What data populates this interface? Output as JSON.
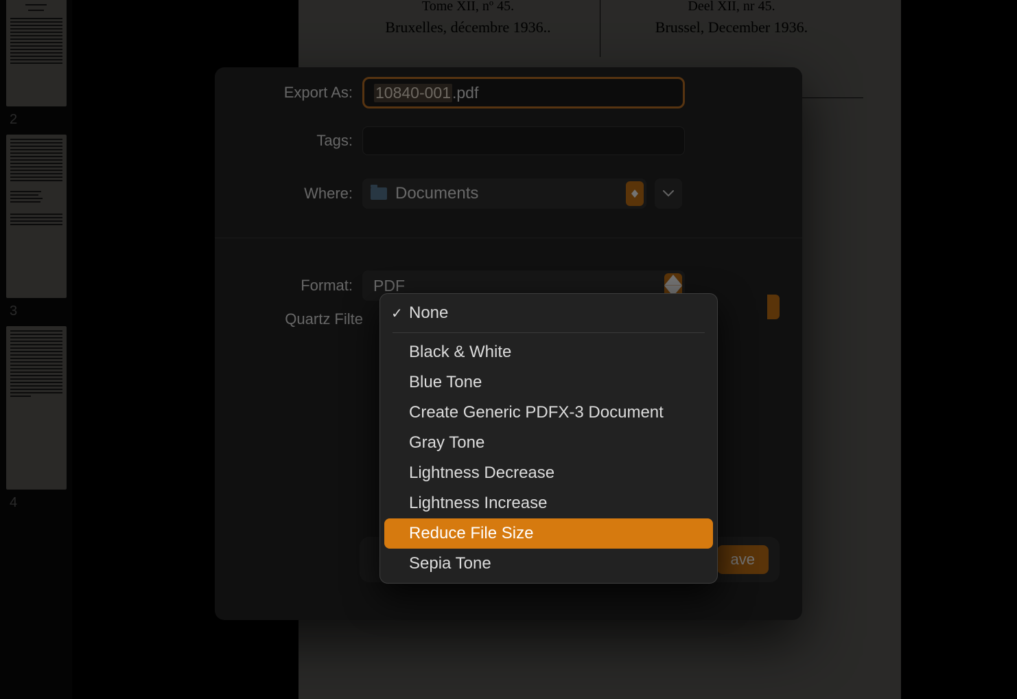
{
  "sidebar": {
    "pages": [
      "2",
      "3",
      "4"
    ]
  },
  "doc": {
    "left_line1": "Tome XII, nº 45.",
    "left_line2": "Bruxelles, décembre 1936..",
    "right_line1": "Deel XII, nr 45.",
    "right_line2": "Brussel, December 1936."
  },
  "dialog": {
    "export_label": "Export As:",
    "filename_base": "10840-001",
    "filename_ext": ".pdf",
    "tags_label": "Tags:",
    "where_label": "Where:",
    "where_value": "Documents",
    "format_label": "Format:",
    "format_value": "PDF",
    "filter_label": "Quartz Filte",
    "save_label": "ave"
  },
  "menu": {
    "items": [
      "None",
      "Black & White",
      "Blue Tone",
      "Create Generic PDFX-3 Document",
      "Gray Tone",
      "Lightness Decrease",
      "Lightness Increase",
      "Reduce File Size",
      "Sepia Tone"
    ],
    "checked_index": 0,
    "highlighted_index": 7
  }
}
